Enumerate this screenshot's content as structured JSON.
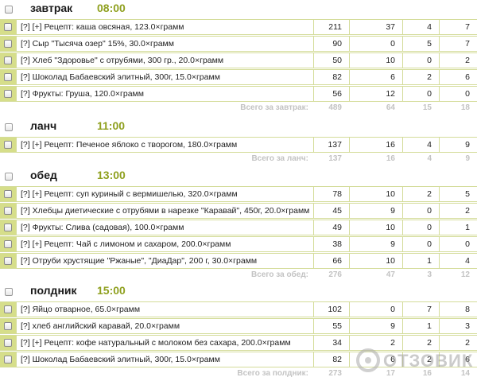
{
  "meals": [
    {
      "name": "завтрак",
      "time": "08:00",
      "items": [
        {
          "label": "[?] [+] Рецепт: каша овсяная, 123.0×грамм",
          "values": [
            "211",
            "37",
            "4",
            "7"
          ]
        },
        {
          "label": "[?] Сыр \"Тысяча озер\" 15%, 30.0×грамм",
          "values": [
            "90",
            "0",
            "5",
            "7"
          ]
        },
        {
          "label": "[?] Хлеб \"Здоровье\" с отрубями, 300 гр., 20.0×грамм",
          "values": [
            "50",
            "10",
            "0",
            "2"
          ]
        },
        {
          "label": "[?] Шоколад Бабаевский элитный, 300г, 15.0×грамм",
          "values": [
            "82",
            "6",
            "2",
            "6"
          ]
        },
        {
          "label": "[?] Фрукты: Груша, 120.0×грамм",
          "values": [
            "56",
            "12",
            "0",
            "0"
          ]
        }
      ],
      "total_label": "Всего за завтрак:",
      "totals": [
        "489",
        "64",
        "15",
        "18"
      ]
    },
    {
      "name": "ланч",
      "time": "11:00",
      "items": [
        {
          "label": "[?] [+] Рецепт: Печеное яблоко с творогом, 180.0×грамм",
          "values": [
            "137",
            "16",
            "4",
            "9"
          ]
        }
      ],
      "total_label": "Всего за ланч:",
      "totals": [
        "137",
        "16",
        "4",
        "9"
      ]
    },
    {
      "name": "обед",
      "time": "13:00",
      "items": [
        {
          "label": "[?] [+] Рецепт: суп куриный с вермишелью, 320.0×грамм",
          "values": [
            "78",
            "10",
            "2",
            "5"
          ]
        },
        {
          "label": "[?] Хлебцы диетические с отрубями в нарезке \"Каравай\", 450г, 20.0×грамм",
          "values": [
            "45",
            "9",
            "0",
            "2"
          ]
        },
        {
          "label": "[?] Фрукты: Слива (садовая), 100.0×грамм",
          "values": [
            "49",
            "10",
            "0",
            "1"
          ]
        },
        {
          "label": "[?] [+] Рецепт: Чай с лимоном и сахаром, 200.0×грамм",
          "values": [
            "38",
            "9",
            "0",
            "0"
          ]
        },
        {
          "label": "[?] Отруби хрустящие \"Ржаные\", \"ДиаДар\", 200 г, 30.0×грамм",
          "values": [
            "66",
            "10",
            "1",
            "4"
          ]
        }
      ],
      "total_label": "Всего за обед:",
      "totals": [
        "276",
        "47",
        "3",
        "12"
      ]
    },
    {
      "name": "полдник",
      "time": "15:00",
      "items": [
        {
          "label": "[?] Яйцо отварное, 65.0×грамм",
          "values": [
            "102",
            "0",
            "7",
            "8"
          ]
        },
        {
          "label": "[?] хлеб английский каравай, 20.0×грамм",
          "values": [
            "55",
            "9",
            "1",
            "3"
          ]
        },
        {
          "label": "[?] [+] Рецепт: кофе натуральный с молоком без сахара, 200.0×грамм",
          "values": [
            "34",
            "2",
            "2",
            "2"
          ]
        },
        {
          "label": "[?] Шоколад Бабаевский элитный, 300г, 15.0×грамм",
          "values": [
            "82",
            "6",
            "2",
            "6"
          ]
        }
      ],
      "total_label": "Всего за полдник:",
      "totals": [
        "273",
        "17",
        "16",
        "14"
      ]
    }
  ],
  "watermark": {
    "text": "ОТЗОВИК"
  }
}
